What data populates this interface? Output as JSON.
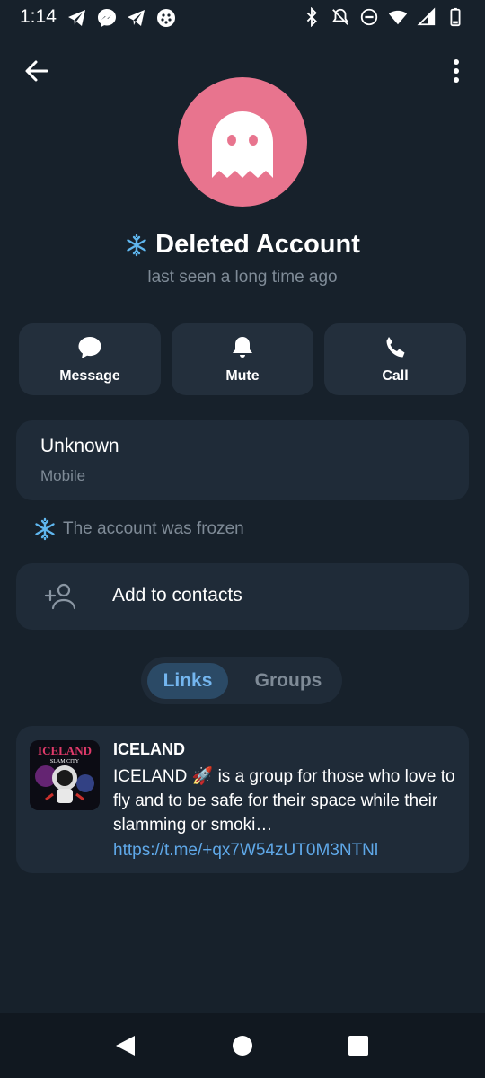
{
  "status_bar": {
    "time": "1:14"
  },
  "header": {
    "back_icon": "arrow-left-icon",
    "menu_icon": "more-vertical-icon"
  },
  "profile": {
    "avatar_icon": "ghost-icon",
    "avatar_color": "#e8748e",
    "name": "Deleted Account",
    "last_seen": "last seen a long time ago"
  },
  "actions": [
    {
      "label": "Message",
      "icon": "chat-bubble-icon"
    },
    {
      "label": "Mute",
      "icon": "bell-icon"
    },
    {
      "label": "Call",
      "icon": "phone-icon"
    }
  ],
  "info": {
    "value": "Unknown",
    "label": "Mobile"
  },
  "frozen_notice": "The account was frozen",
  "add_contact": {
    "label": "Add to contacts",
    "icon": "add-person-icon"
  },
  "tabs": [
    {
      "label": "Links",
      "active": true
    },
    {
      "label": "Groups",
      "active": false
    }
  ],
  "link_item": {
    "title": "ICELAND",
    "description": "ICELAND 🚀 is a group for those who love to fly and  to be safe for their space while their slamming or smoki…",
    "url": "https://t.me/+qx7W54zUT0M3NTNl",
    "thumbnail_text": "ICELAND",
    "thumbnail_subtext": "SLAM CITY"
  },
  "colors": {
    "background": "#17212b",
    "card": "#1f2b38",
    "accent": "#5fa8e8",
    "muted": "#7f8b97"
  }
}
